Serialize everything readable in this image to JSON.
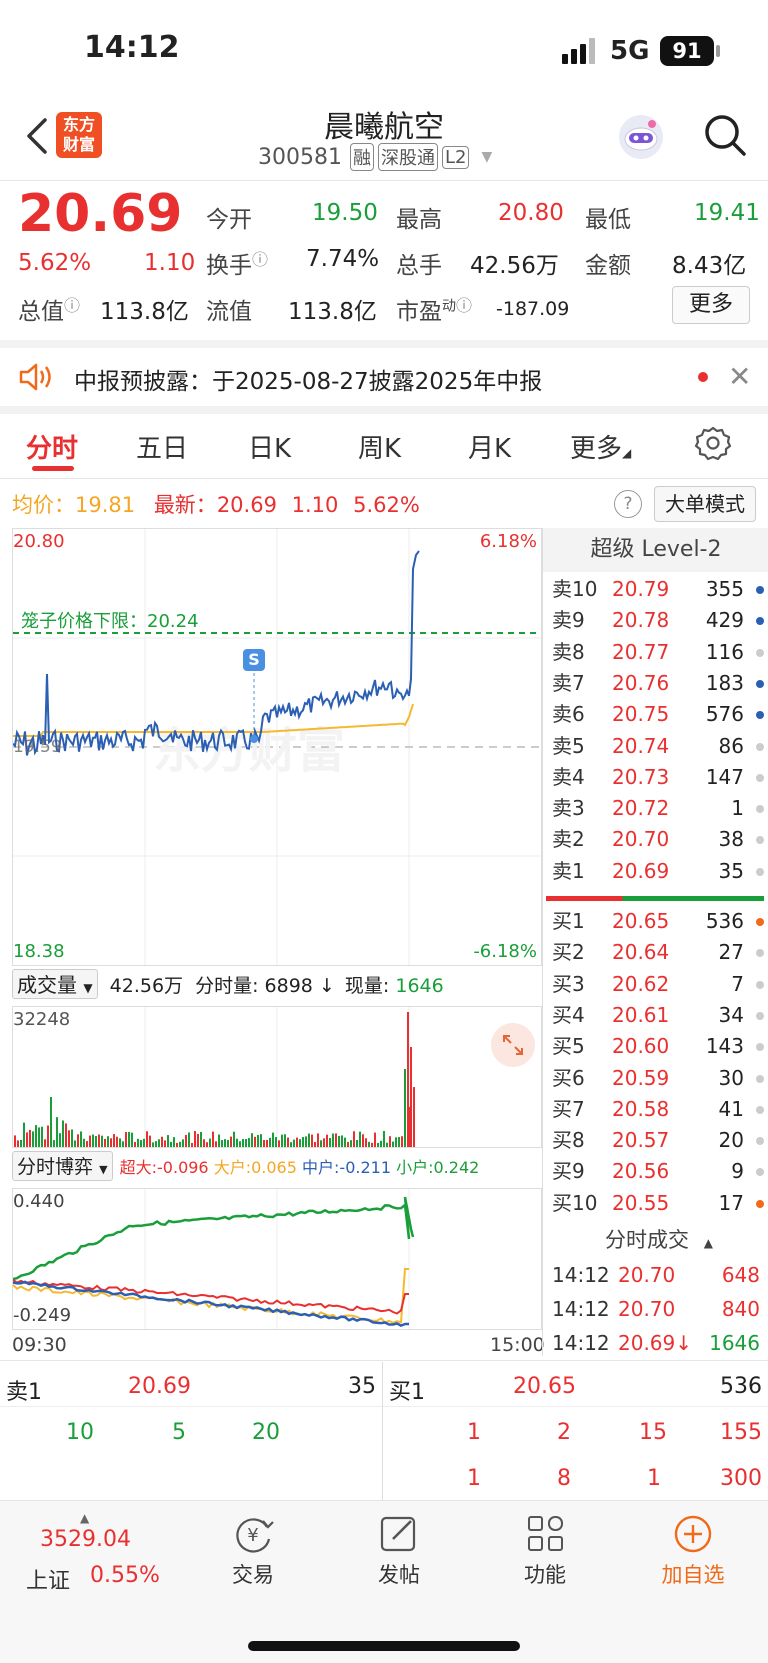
{
  "status_bar": {
    "time": "14:12",
    "network": "5G",
    "battery": "91"
  },
  "header": {
    "logo_line1": "东方",
    "logo_line2": "财富",
    "title": "晨曦航空",
    "code": "300581",
    "tags": [
      "融",
      "深股通",
      "L2"
    ]
  },
  "quote": {
    "price": "20.69",
    "pct": "5.62%",
    "chg": "1.10",
    "open_label": "今开",
    "open": "19.50",
    "high_label": "最高",
    "high": "20.80",
    "low_label": "最低",
    "low": "19.41",
    "turnover_label": "换手",
    "turnover": "7.74%",
    "volume_label": "总手",
    "volume": "42.56万",
    "amount_label": "金额",
    "amount": "8.43亿",
    "mktcap_label": "总值",
    "mktcap": "113.8亿",
    "float_label": "流值",
    "float": "113.8亿",
    "pe_label": "市盈",
    "pe_sup": "动",
    "pe": "-187.09",
    "more": "更多"
  },
  "notice": {
    "text": "中报预披露：于2025-08-27披露2025年中报"
  },
  "tabs": [
    {
      "label": "分时"
    },
    {
      "label": "五日"
    },
    {
      "label": "日K"
    },
    {
      "label": "周K"
    },
    {
      "label": "月K"
    },
    {
      "label": "更多"
    }
  ],
  "chart_info": {
    "avg_label": "均价：",
    "avg": "19.81",
    "latest_label": "最新：",
    "latest": "20.69",
    "chg": "1.10",
    "pct": "5.62%",
    "mode": "大单模式"
  },
  "price_chart": {
    "ymax": "20.80",
    "ymin": "18.38",
    "pct_max": "6.18%",
    "pct_min": "-6.18%",
    "prev_close": "19.59",
    "limit_label": "笼子价格下限：",
    "limit": "20.24",
    "signal": "S",
    "watermark": "东方财富",
    "x_start": "09:30",
    "x_end": "15:00"
  },
  "volume_bar": {
    "selector": "成交量",
    "total": "42.56万",
    "tick_label": "分时量:",
    "tick": "6898",
    "arrow": "↓",
    "cur_label": "现量:",
    "cur": "1646",
    "ymax": "32248"
  },
  "flow_bar": {
    "selector": "分时博弈",
    "super_label": "超大:",
    "super": "-0.096",
    "big_label": "大户:",
    "big": "0.065",
    "mid_label": "中户:",
    "mid": "-0.211",
    "small_label": "小户:",
    "small": "0.242",
    "ymax": "0.440",
    "ymin": "-0.249"
  },
  "orderbook": {
    "title": "超级 Level-2",
    "asks": [
      {
        "label": "卖10",
        "price": "20.79",
        "vol": "355"
      },
      {
        "label": "卖9",
        "price": "20.78",
        "vol": "429"
      },
      {
        "label": "卖8",
        "price": "20.77",
        "vol": "116"
      },
      {
        "label": "卖7",
        "price": "20.76",
        "vol": "183"
      },
      {
        "label": "卖6",
        "price": "20.75",
        "vol": "576"
      },
      {
        "label": "卖5",
        "price": "20.74",
        "vol": "86"
      },
      {
        "label": "卖4",
        "price": "20.73",
        "vol": "147"
      },
      {
        "label": "卖3",
        "price": "20.72",
        "vol": "1"
      },
      {
        "label": "卖2",
        "price": "20.70",
        "vol": "38"
      },
      {
        "label": "卖1",
        "price": "20.69",
        "vol": "35"
      }
    ],
    "bids": [
      {
        "label": "买1",
        "price": "20.65",
        "vol": "536"
      },
      {
        "label": "买2",
        "price": "20.64",
        "vol": "27"
      },
      {
        "label": "买3",
        "price": "20.62",
        "vol": "7"
      },
      {
        "label": "买4",
        "price": "20.61",
        "vol": "34"
      },
      {
        "label": "买5",
        "price": "20.60",
        "vol": "143"
      },
      {
        "label": "买6",
        "price": "20.59",
        "vol": "30"
      },
      {
        "label": "买7",
        "price": "20.58",
        "vol": "41"
      },
      {
        "label": "买8",
        "price": "20.57",
        "vol": "20"
      },
      {
        "label": "买9",
        "price": "20.56",
        "vol": "9"
      },
      {
        "label": "买10",
        "price": "20.55",
        "vol": "17"
      }
    ],
    "ticks_title": "分时成交",
    "ticks": [
      {
        "time": "14:12",
        "price": "20.70",
        "vol": "648"
      },
      {
        "time": "14:12",
        "price": "20.70",
        "vol": "840"
      },
      {
        "time": "14:12",
        "price": "20.69↓",
        "vol": "1646"
      }
    ]
  },
  "queue": {
    "ask_label": "卖1",
    "ask_price": "20.69",
    "ask_vol": "35",
    "bid_label": "买1",
    "bid_price": "20.65",
    "bid_vol": "536",
    "ask_orders": [
      "10",
      "5",
      "20"
    ],
    "bid_orders_row1": [
      "1",
      "2",
      "15",
      "155"
    ],
    "bid_orders_row2": [
      "1",
      "8",
      "1",
      "300"
    ]
  },
  "bottom_nav": {
    "index_value": "3529.04",
    "index_name": "上证",
    "index_pct": "0.55%",
    "trade": "交易",
    "post": "发帖",
    "func": "功能",
    "add": "加自选"
  }
}
